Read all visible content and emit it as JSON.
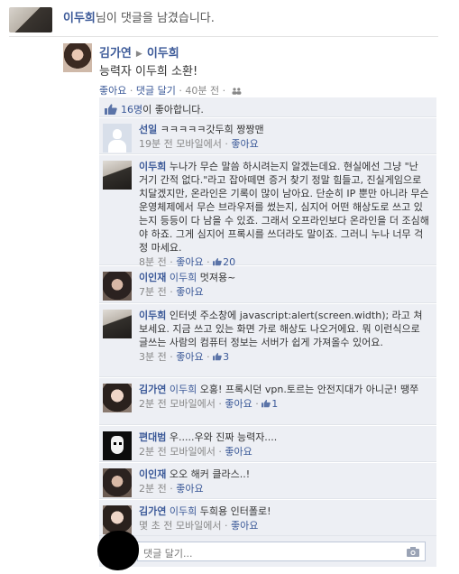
{
  "notification": {
    "actor": "이두희",
    "text": "님이 댓글을 남겼습니다."
  },
  "post": {
    "author": "김가연",
    "target": "이두희",
    "body": "능력자 이두희 소환!",
    "like": "좋아요",
    "comment": "댓글 달기",
    "time": "40분 전",
    "sep": "·"
  },
  "likes": {
    "count": "16명",
    "text": "이 좋아합니다."
  },
  "comments": [
    {
      "author": "선일",
      "text": "ㅋㅋㅋㅋㅋ갓두희 짱짱맨",
      "time": "19분 전",
      "mobile": "모바일에서",
      "like": "좋아요"
    },
    {
      "author": "이두희",
      "text": "누나가 무슨 말씀 하시려는지 알겠는데요. 현실에선 그냥 \"난 거기 간적 없다.\"라고 잡아떼면 증거 찾기 정말 힘들고, 진실게임으로 치달겠지만, 온라인은 기록이 많이 남아요. 단순히 IP 뿐만 아니라 무슨 운영체제에서 무슨 브라우저를 썼는지, 심지어 어떤 해상도로 쓰고 있는지 등등이 다 남을 수 있죠. 그래서 오프라인보다 온라인을 더 조심해야 하죠. 그게 심지어 프록시를 쓰더라도 말이죠. 그러니 누나 너무 걱정 마세요.",
      "time": "8분 전",
      "like": "좋아요",
      "likes": "20"
    },
    {
      "author": "이인재",
      "tag": "이두희",
      "text": "멋져용~",
      "time": "7분 전",
      "like": "좋아요"
    },
    {
      "author": "이두희",
      "text": "인터넷 주소창에 javascript:alert(screen.width); 라고 쳐 보세요. 지금 쓰고 있는 화면 가로 해상도 나오거에요. 뭐 이런식으로 글쓰는 사람의 컴퓨터 정보는 서버가 쉽게 가져올수 있어요.",
      "time": "3분 전",
      "like": "좋아요",
      "likes": "3"
    },
    {
      "author": "김가연",
      "tag": "이두희",
      "text": "오홍! 프록시던 vpn.토르는 안전지대가 아니군! 땡쭈",
      "time": "2분 전",
      "mobile": "모바일에서",
      "like": "좋아요",
      "likes": "1"
    },
    {
      "author": "편대범",
      "text": "우.....우와 진짜 능력자....",
      "time": "2분 전",
      "mobile": "모바일에서",
      "like": "좋아요"
    },
    {
      "author": "이인재",
      "text": "오오 해커 클라스..!",
      "time": "2분 전",
      "like": "좋아요"
    },
    {
      "author": "김가연",
      "tag": "이두희",
      "text": "두희용 인터폴로!",
      "time": "몇 초 전",
      "mobile": "모바일에서",
      "like": "좋아요"
    }
  ],
  "compose": {
    "placeholder": "댓글 달기..."
  },
  "colors": {
    "link": "#3b5998",
    "panel": "#edeff4",
    "meta": "#888888"
  },
  "icons": [
    "people-icon",
    "like-thumb-icon",
    "camera-icon"
  ]
}
